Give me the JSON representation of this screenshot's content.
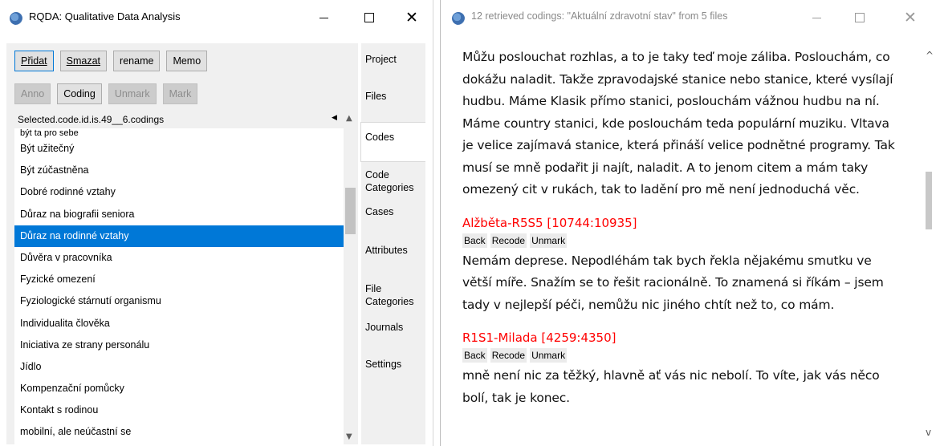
{
  "window1": {
    "title": "RQDA: Qualitative Data Analysis",
    "buttons_row1": [
      {
        "label": "Přidat"
      },
      {
        "label": "Smazat"
      },
      {
        "label": "rename"
      },
      {
        "label": "Memo"
      }
    ],
    "buttons_row2": [
      {
        "label": "Anno"
      },
      {
        "label": "Coding"
      },
      {
        "label": "Unmark"
      },
      {
        "label": "Mark"
      }
    ],
    "selected_label": "Selected.code.id.is.49__6.codings",
    "list_partial_top": "být ta pro sebe",
    "codes": [
      "Být užitečný",
      "Být zúčastněna",
      "Dobré rodinné vztahy",
      "Důraz na biografii seniora",
      "Důraz na rodinné vztahy",
      "Důvěra v pracovníka",
      "Fyzické omezení",
      "Fyziologické stárnutí organismu",
      "Individualita člověka",
      "Iniciativa ze strany personálu",
      "Jídlo",
      "Kompenzační pomůcky",
      "Kontakt s rodinou",
      "mobilní, ale neúčastní se"
    ],
    "selected_code": "Důraz na rodinné vztahy",
    "tabs": [
      "Project",
      "Files",
      "Codes",
      "Code Categories",
      "Cases",
      "Attributes",
      "File Categories",
      "Journals",
      "Settings"
    ],
    "active_tab": "Codes"
  },
  "window2": {
    "title": "12 retrieved codings: \"Aktuální zdravotní stav\" from 5 files",
    "action_labels": [
      "Back",
      "Recode",
      "Unmark"
    ],
    "block0_lines": [
      "Můžu poslouchat rozhlas, a to je taky teď moje záliba. Poslouchám, co",
      "dokážu naladit. Takže zpravodajské stanice nebo stanice, které vysílají",
      "hudbu. Máme Klasik přímo stanici, poslouchám vážnou hudbu na ní.",
      "Máme country stanici, kde poslouchám teda populární muziku. Vltava",
      "je velice zajímavá stanice, která přináší velice podnětné programy. Tak",
      "musí se mně podařit ji najít, naladit. A to jenom citem a mám taky",
      "omezený cit v rukách, tak to ladění pro mě není jednoduchá věc."
    ],
    "block1_citation": "Alžběta-R5S5 [10744:10935]",
    "block1_lines": [
      "Nemám deprese. Nepodléhám tak bych řekla nějakému smutku ve",
      "větší míře. Snažím se to řešit racionálně. To znamená si říkám – jsem",
      "tady v nejlepší péči, nemůžu nic jiného chtít než to, co mám."
    ],
    "block2_citation": "R1S1-Milada [4259:4350]",
    "block2_lines": [
      "mně není nic za těžký, hlavně ať vás nic nebolí. To víte, jak vás něco",
      "bolí, tak je konec."
    ]
  }
}
